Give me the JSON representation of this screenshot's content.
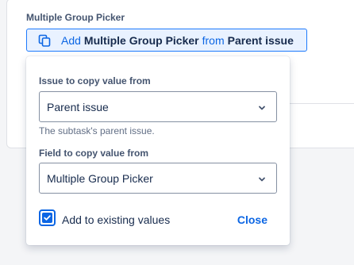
{
  "field": {
    "label": "Multiple Group Picker"
  },
  "trigger": {
    "icon": "copy-icon",
    "add": "Add",
    "field_name": "Multiple Group Picker",
    "from": "from",
    "source": "Parent issue"
  },
  "popup": {
    "issue_label": "Issue to copy value from",
    "issue_value": "Parent issue",
    "issue_helper": "The subtask's parent issue.",
    "field_label": "Field to copy value from",
    "field_value": "Multiple Group Picker",
    "checkbox_label": "Add to existing values",
    "checkbox_checked": true,
    "close_label": "Close"
  },
  "colors": {
    "accent": "#0c66e4",
    "trigger_bg": "#e9f2ff",
    "text": "#172b4d",
    "subtle": "#626f86"
  }
}
